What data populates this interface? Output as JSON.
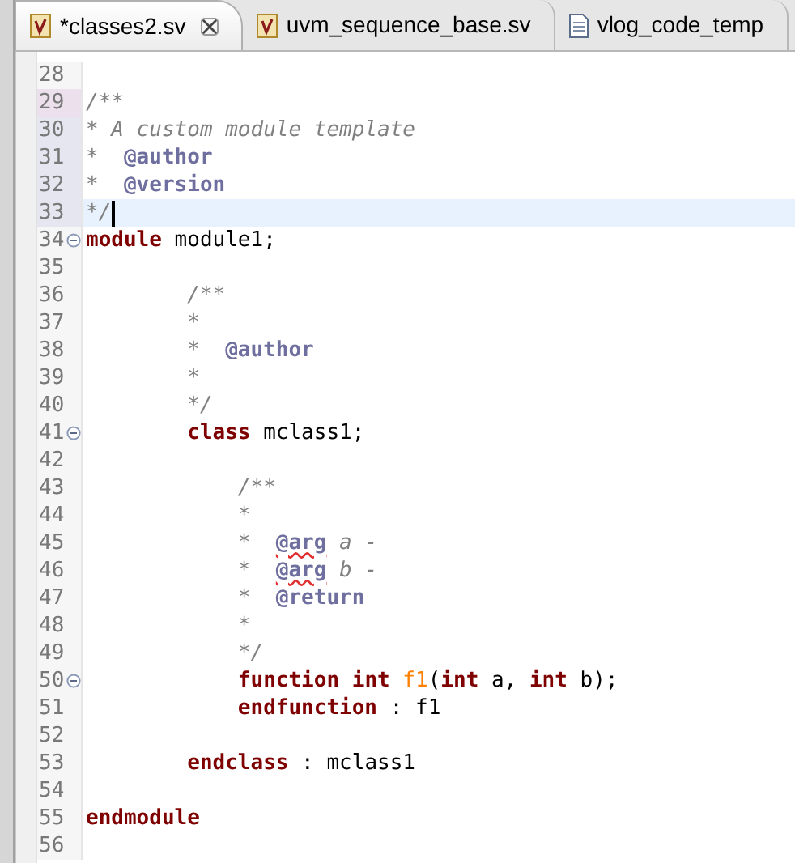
{
  "tabs": [
    {
      "label": "*classes2.sv",
      "selected": true,
      "kind": "verilog",
      "closable": true
    },
    {
      "label": "uvm_sequence_base.sv",
      "selected": false,
      "kind": "verilog",
      "closable": false
    },
    {
      "label": "vlog_code_temp",
      "selected": false,
      "kind": "text",
      "closable": false
    }
  ],
  "editor": {
    "lines": [
      {
        "number": "28"
      },
      {
        "number": "29",
        "modified": true,
        "tokens": [
          {
            "kind": "comment",
            "text": "/**"
          }
        ]
      },
      {
        "number": "30",
        "added": true,
        "tokens": [
          {
            "kind": "comment",
            "text": "* A custom module template"
          }
        ]
      },
      {
        "number": "31",
        "added": true,
        "tokens": [
          {
            "kind": "comment",
            "text": "*  "
          },
          {
            "kind": "doctag",
            "text": "@author"
          }
        ]
      },
      {
        "number": "32",
        "added": true,
        "tokens": [
          {
            "kind": "comment",
            "text": "*  "
          },
          {
            "kind": "doctag",
            "text": "@version"
          }
        ]
      },
      {
        "number": "33",
        "added": true,
        "current": true,
        "tokens": [
          {
            "kind": "comment",
            "text": "*/"
          }
        ]
      },
      {
        "number": "34",
        "foldable": true,
        "tokens": [
          {
            "kind": "keyword",
            "text": "module"
          },
          {
            "kind": "plain",
            "text": " module1;"
          }
        ]
      },
      {
        "number": "35"
      },
      {
        "number": "36",
        "tokens": [
          {
            "kind": "comment",
            "text": "        /**"
          }
        ]
      },
      {
        "number": "37",
        "tokens": [
          {
            "kind": "comment",
            "text": "        *"
          }
        ]
      },
      {
        "number": "38",
        "tokens": [
          {
            "kind": "comment",
            "text": "        *  "
          },
          {
            "kind": "doctag",
            "text": "@author"
          }
        ]
      },
      {
        "number": "39",
        "tokens": [
          {
            "kind": "comment",
            "text": "        *"
          }
        ]
      },
      {
        "number": "40",
        "tokens": [
          {
            "kind": "comment",
            "text": "        */"
          }
        ]
      },
      {
        "number": "41",
        "foldable": true,
        "tokens": [
          {
            "kind": "keyword",
            "text": "        class"
          },
          {
            "kind": "plain",
            "text": " mclass1;"
          }
        ]
      },
      {
        "number": "42"
      },
      {
        "number": "43",
        "tokens": [
          {
            "kind": "comment",
            "text": "            /**"
          }
        ]
      },
      {
        "number": "44",
        "tokens": [
          {
            "kind": "comment",
            "text": "            *"
          }
        ]
      },
      {
        "number": "45",
        "tokens": [
          {
            "kind": "comment",
            "text": "            *  "
          },
          {
            "kind": "doctag_misspelled",
            "text": "@arg"
          },
          {
            "kind": "comment",
            "text": " a -"
          }
        ]
      },
      {
        "number": "46",
        "tokens": [
          {
            "kind": "comment",
            "text": "            *  "
          },
          {
            "kind": "doctag_misspelled",
            "text": "@arg"
          },
          {
            "kind": "comment",
            "text": " b -"
          }
        ]
      },
      {
        "number": "47",
        "tokens": [
          {
            "kind": "comment",
            "text": "            *  "
          },
          {
            "kind": "doctag",
            "text": "@return"
          }
        ]
      },
      {
        "number": "48",
        "tokens": [
          {
            "kind": "comment",
            "text": "            *"
          }
        ]
      },
      {
        "number": "49",
        "tokens": [
          {
            "kind": "comment",
            "text": "            */"
          }
        ]
      },
      {
        "number": "50",
        "foldable": true,
        "tokens": [
          {
            "kind": "keyword",
            "text": "            function"
          },
          {
            "kind": "keyword",
            "text": " int"
          },
          {
            "kind": "function_name",
            "text": " f1"
          },
          {
            "kind": "plain",
            "text": "("
          },
          {
            "kind": "keyword",
            "text": "int"
          },
          {
            "kind": "plain",
            "text": " a, "
          },
          {
            "kind": "keyword",
            "text": "int"
          },
          {
            "kind": "plain",
            "text": " b);"
          }
        ]
      },
      {
        "number": "51",
        "tokens": [
          {
            "kind": "keyword",
            "text": "            endfunction"
          },
          {
            "kind": "plain",
            "text": " : f1"
          }
        ]
      },
      {
        "number": "52"
      },
      {
        "number": "53",
        "tokens": [
          {
            "kind": "keyword",
            "text": "        endclass"
          },
          {
            "kind": "plain",
            "text": " : mclass1"
          }
        ]
      },
      {
        "number": "54"
      },
      {
        "number": "55",
        "tokens": [
          {
            "kind": "keyword",
            "text": "endmodule"
          }
        ]
      },
      {
        "number": "56"
      }
    ]
  }
}
